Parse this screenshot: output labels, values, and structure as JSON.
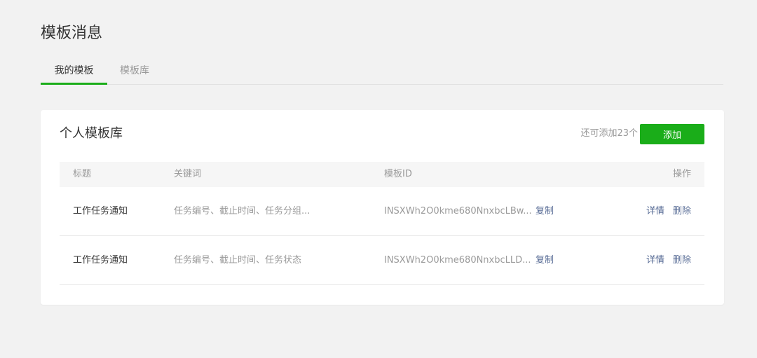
{
  "page": {
    "title": "模板消息"
  },
  "tabs": [
    {
      "label": "我的模板",
      "active": true
    },
    {
      "label": "模板库",
      "active": false
    }
  ],
  "card": {
    "title": "个人模板库",
    "remaining": "还可添加23个",
    "add_label": "添加"
  },
  "table": {
    "headers": {
      "title": "标题",
      "keywords": "关键词",
      "template_id": "模板ID",
      "actions": "操作"
    },
    "rows": [
      {
        "title": "工作任务通知",
        "keywords": "任务编号、截止时间、任务分组...",
        "template_id": "INSXWh2O0kme680NnxbcLBw...",
        "copy": "复制",
        "detail": "详情",
        "delete": "删除"
      },
      {
        "title": "工作任务通知",
        "keywords": "任务编号、截止时间、任务状态",
        "template_id": "INSXWh2O0kme680NnxbcLLD...",
        "copy": "复制",
        "detail": "详情",
        "delete": "删除"
      }
    ]
  },
  "colors": {
    "accent": "#1aad19",
    "link": "#576b95",
    "background": "#f2f2f2",
    "muted_text": "#9a9a9a"
  }
}
